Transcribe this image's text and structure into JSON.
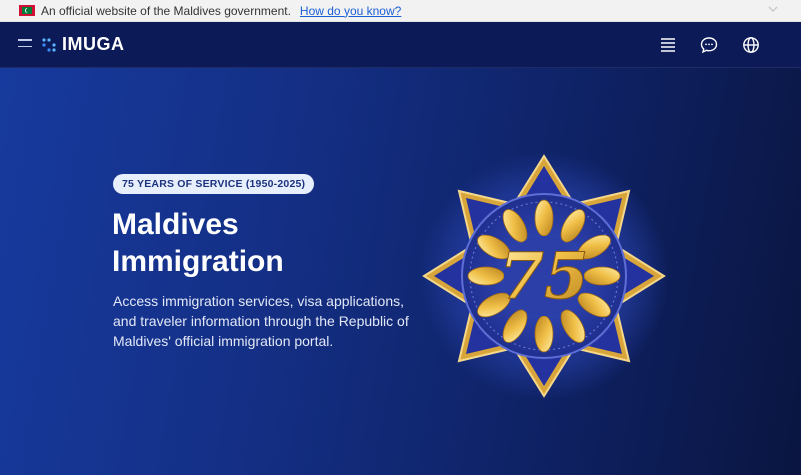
{
  "gov_banner": {
    "text": "An official website of the Maldives government.",
    "link": "How do you know?"
  },
  "header": {
    "logo_text": "IMUGA",
    "icons": [
      "menu-lines-icon",
      "chat-icon",
      "globe-icon"
    ]
  },
  "hero": {
    "pill": "75 YEARS OF SERVICE (1950-2025)",
    "title": "Maldives Immigration",
    "description": "Access immigration services, visa applications, and traveler information through the Republic of Maldives' official immigration portal.",
    "emblem_number": "75"
  },
  "colors": {
    "banner_bg": "#f2f2f2",
    "link": "#1a5fd6",
    "header_bg": "#0c1a57",
    "hero_start": "#173a9e",
    "hero_end": "#0a1540",
    "gold": "#e8b33c",
    "emblem_blue": "#2b3ea8"
  }
}
